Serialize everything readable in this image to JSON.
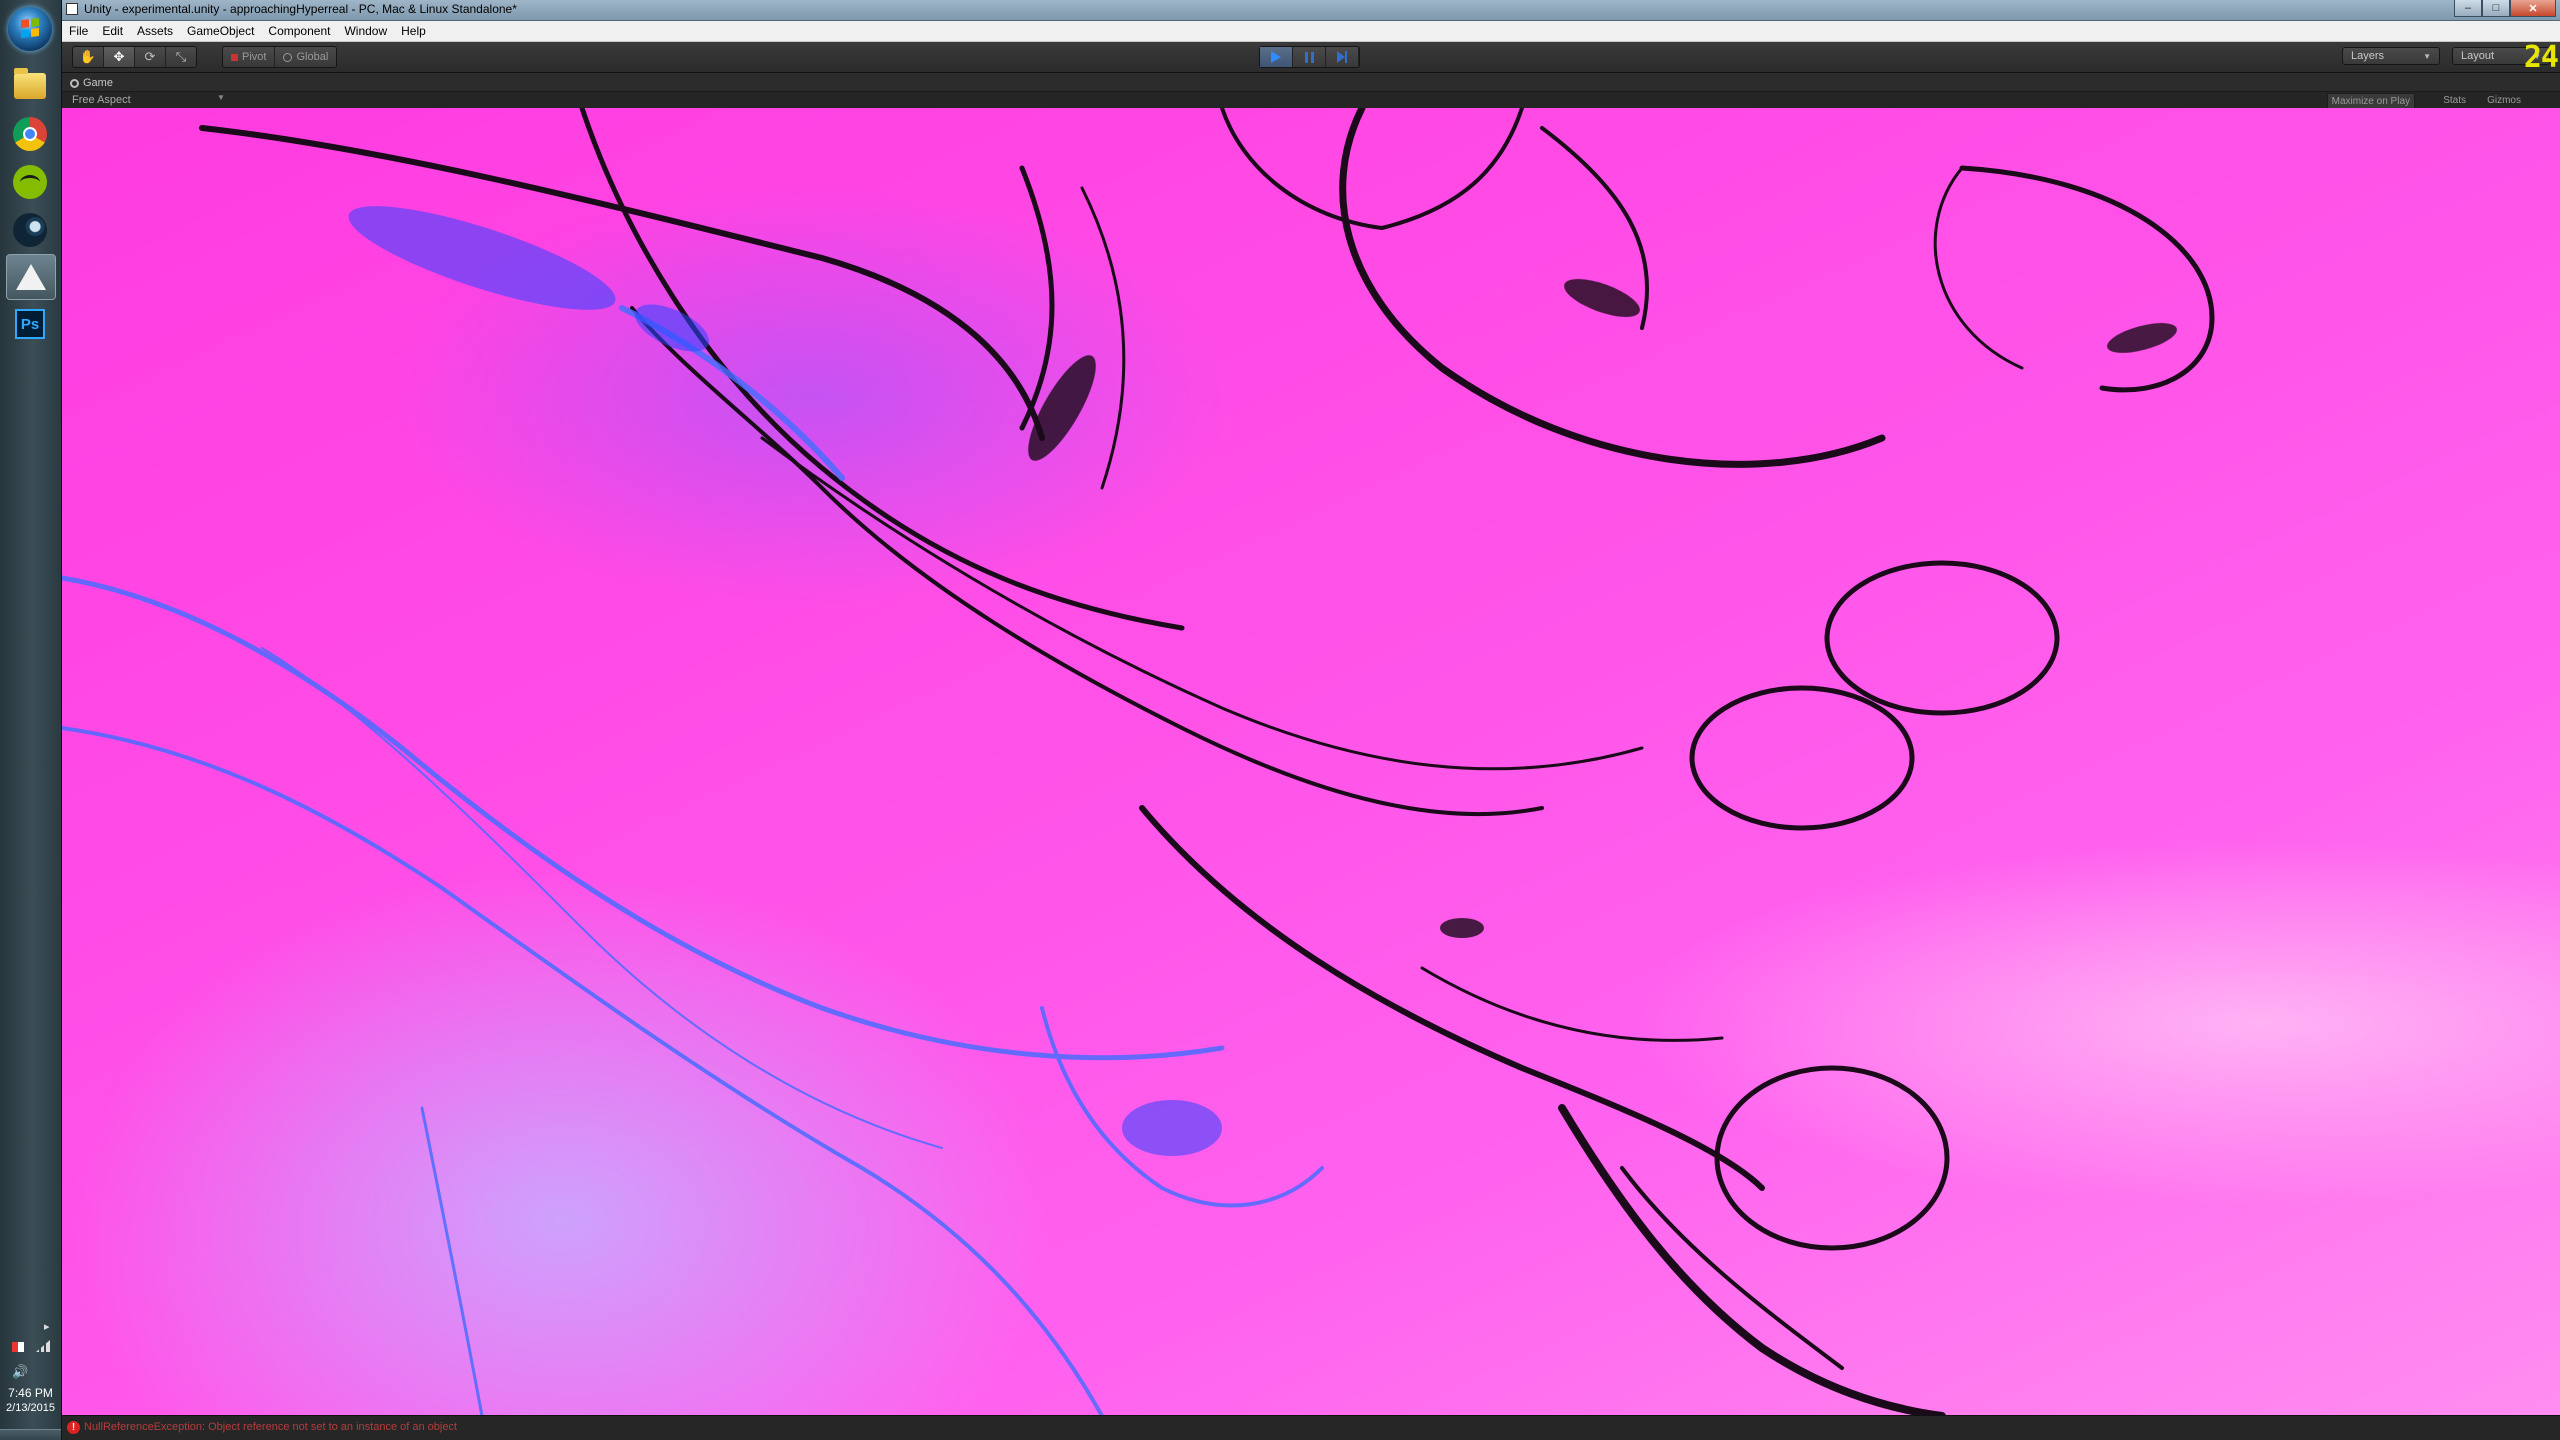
{
  "taskbar": {
    "apps": [
      {
        "name": "Windows Explorer",
        "icon": "folder-icon"
      },
      {
        "name": "Google Chrome",
        "icon": "chrome-icon"
      },
      {
        "name": "Spotify",
        "icon": "spotify-icon"
      },
      {
        "name": "Steam",
        "icon": "steam-icon"
      },
      {
        "name": "Unity",
        "icon": "unity-icon",
        "active": true
      },
      {
        "name": "Photoshop",
        "icon": "photoshop-icon",
        "label": "Ps"
      }
    ],
    "clock": {
      "time": "7:46 PM",
      "date": "2/13/2015"
    },
    "tray_arrow": "▸",
    "volume_icon": "🔊"
  },
  "window": {
    "title": "Unity - experimental.unity - approachingHyperreal - PC, Mac & Linux Standalone*",
    "controls": {
      "minimize": "–",
      "maximize": "□",
      "close": "✕"
    }
  },
  "menu": [
    "File",
    "Edit",
    "Assets",
    "GameObject",
    "Component",
    "Window",
    "Help"
  ],
  "toolbar": {
    "tools": [
      {
        "name": "hand-tool",
        "glyph": "✋"
      },
      {
        "name": "move-tool",
        "glyph": "✥",
        "on": true
      },
      {
        "name": "rotate-tool",
        "glyph": "⟳"
      },
      {
        "name": "scale-tool",
        "glyph": "⤡"
      }
    ],
    "pivot_label": "Pivot",
    "global_label": "Global",
    "layers_label": "Layers",
    "layout_label": "Layout",
    "fps_counter": "24",
    "accent_color": "#2f8cff",
    "play_state": "playing"
  },
  "game_view": {
    "tab_label": "Game",
    "aspect_label": "Free Aspect",
    "maximize_on_play_label": "Maximize on Play",
    "stats_label": "Stats",
    "gizmos_label": "Gizmos",
    "background_color": "#ff3be0"
  },
  "status": {
    "message": "NullReferenceException: Object reference not set to an instance of an object",
    "level": "error",
    "color": "#b53c3c"
  }
}
